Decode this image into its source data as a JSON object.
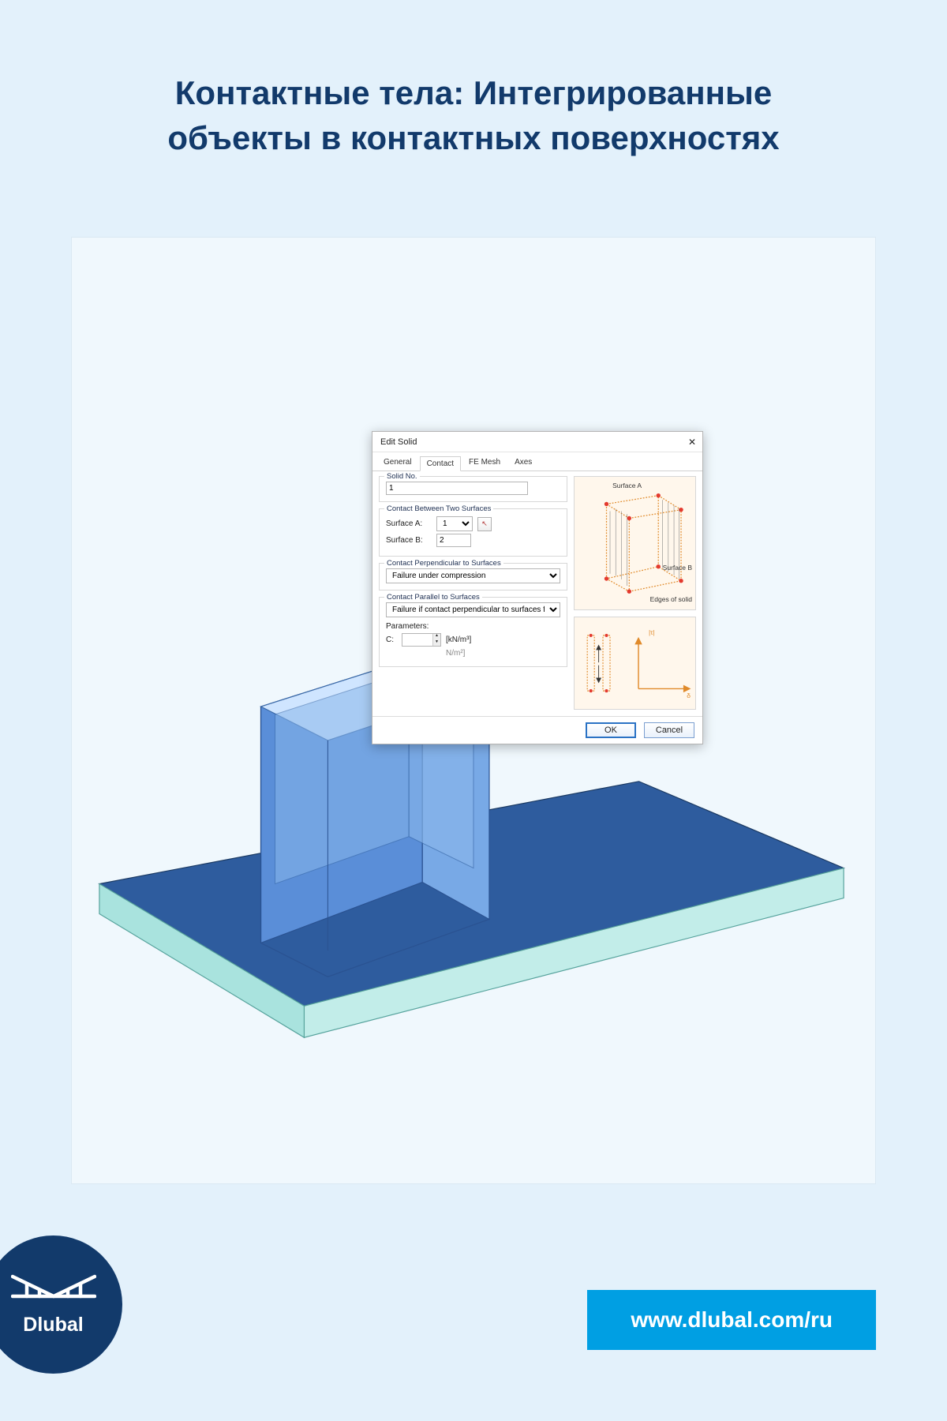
{
  "heading_line1": "Контактные тела: Интегрированные",
  "heading_line2": "объекты в контактных поверхностях",
  "brand_name": "Dlubal",
  "brand_url": "www.dlubal.com/ru",
  "dialog": {
    "title": "Edit Solid",
    "tabs": {
      "general": "General",
      "contact": "Contact",
      "fe_mesh": "FE Mesh",
      "axes": "Axes"
    },
    "solid_no_label": "Solid No.",
    "solid_no_value": "1",
    "group_contact_between": "Contact Between Two Surfaces",
    "surface_a_label": "Surface A:",
    "surface_a_value": "1",
    "surface_b_label": "Surface B:",
    "surface_b_value": "2",
    "group_perp": "Contact Perpendicular to Surfaces",
    "perp_value": "Failure under compression",
    "group_par": "Contact Parallel to Surfaces",
    "par_value": "Failure if contact perpendicular to surfaces failed",
    "parameters_label": "Parameters:",
    "param_c_label": "C:",
    "param_c_value": "",
    "unit1": "[kN/m³]",
    "unit2": "N/m²]",
    "diag_surface_a": "Surface A",
    "diag_surface_b": "Surface B",
    "diag_edges": "Edges of solid",
    "diag_tau": "|τ|",
    "diag_delta": "δ",
    "ok": "OK",
    "cancel": "Cancel"
  }
}
